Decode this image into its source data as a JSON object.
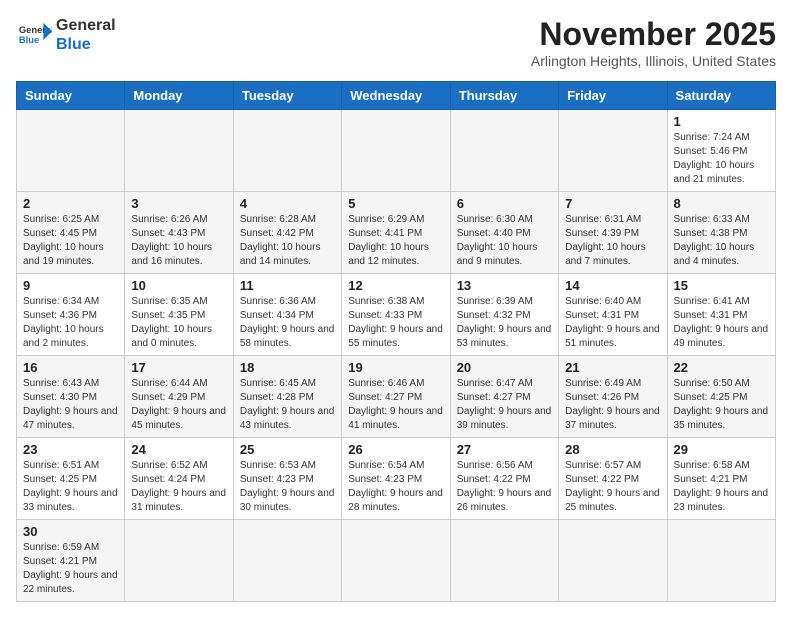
{
  "header": {
    "logo_general": "General",
    "logo_blue": "Blue",
    "month_year": "November 2025",
    "location": "Arlington Heights, Illinois, United States"
  },
  "weekdays": [
    "Sunday",
    "Monday",
    "Tuesday",
    "Wednesday",
    "Thursday",
    "Friday",
    "Saturday"
  ],
  "weeks": [
    [
      {
        "day": "",
        "info": ""
      },
      {
        "day": "",
        "info": ""
      },
      {
        "day": "",
        "info": ""
      },
      {
        "day": "",
        "info": ""
      },
      {
        "day": "",
        "info": ""
      },
      {
        "day": "",
        "info": ""
      },
      {
        "day": "1",
        "info": "Sunrise: 7:24 AM\nSunset: 5:46 PM\nDaylight: 10 hours and 21 minutes."
      }
    ],
    [
      {
        "day": "2",
        "info": "Sunrise: 6:25 AM\nSunset: 4:45 PM\nDaylight: 10 hours and 19 minutes."
      },
      {
        "day": "3",
        "info": "Sunrise: 6:26 AM\nSunset: 4:43 PM\nDaylight: 10 hours and 16 minutes."
      },
      {
        "day": "4",
        "info": "Sunrise: 6:28 AM\nSunset: 4:42 PM\nDaylight: 10 hours and 14 minutes."
      },
      {
        "day": "5",
        "info": "Sunrise: 6:29 AM\nSunset: 4:41 PM\nDaylight: 10 hours and 12 minutes."
      },
      {
        "day": "6",
        "info": "Sunrise: 6:30 AM\nSunset: 4:40 PM\nDaylight: 10 hours and 9 minutes."
      },
      {
        "day": "7",
        "info": "Sunrise: 6:31 AM\nSunset: 4:39 PM\nDaylight: 10 hours and 7 minutes."
      },
      {
        "day": "8",
        "info": "Sunrise: 6:33 AM\nSunset: 4:38 PM\nDaylight: 10 hours and 4 minutes."
      }
    ],
    [
      {
        "day": "9",
        "info": "Sunrise: 6:34 AM\nSunset: 4:36 PM\nDaylight: 10 hours and 2 minutes."
      },
      {
        "day": "10",
        "info": "Sunrise: 6:35 AM\nSunset: 4:35 PM\nDaylight: 10 hours and 0 minutes."
      },
      {
        "day": "11",
        "info": "Sunrise: 6:36 AM\nSunset: 4:34 PM\nDaylight: 9 hours and 58 minutes."
      },
      {
        "day": "12",
        "info": "Sunrise: 6:38 AM\nSunset: 4:33 PM\nDaylight: 9 hours and 55 minutes."
      },
      {
        "day": "13",
        "info": "Sunrise: 6:39 AM\nSunset: 4:32 PM\nDaylight: 9 hours and 53 minutes."
      },
      {
        "day": "14",
        "info": "Sunrise: 6:40 AM\nSunset: 4:31 PM\nDaylight: 9 hours and 51 minutes."
      },
      {
        "day": "15",
        "info": "Sunrise: 6:41 AM\nSunset: 4:31 PM\nDaylight: 9 hours and 49 minutes."
      }
    ],
    [
      {
        "day": "16",
        "info": "Sunrise: 6:43 AM\nSunset: 4:30 PM\nDaylight: 9 hours and 47 minutes."
      },
      {
        "day": "17",
        "info": "Sunrise: 6:44 AM\nSunset: 4:29 PM\nDaylight: 9 hours and 45 minutes."
      },
      {
        "day": "18",
        "info": "Sunrise: 6:45 AM\nSunset: 4:28 PM\nDaylight: 9 hours and 43 minutes."
      },
      {
        "day": "19",
        "info": "Sunrise: 6:46 AM\nSunset: 4:27 PM\nDaylight: 9 hours and 41 minutes."
      },
      {
        "day": "20",
        "info": "Sunrise: 6:47 AM\nSunset: 4:27 PM\nDaylight: 9 hours and 39 minutes."
      },
      {
        "day": "21",
        "info": "Sunrise: 6:49 AM\nSunset: 4:26 PM\nDaylight: 9 hours and 37 minutes."
      },
      {
        "day": "22",
        "info": "Sunrise: 6:50 AM\nSunset: 4:25 PM\nDaylight: 9 hours and 35 minutes."
      }
    ],
    [
      {
        "day": "23",
        "info": "Sunrise: 6:51 AM\nSunset: 4:25 PM\nDaylight: 9 hours and 33 minutes."
      },
      {
        "day": "24",
        "info": "Sunrise: 6:52 AM\nSunset: 4:24 PM\nDaylight: 9 hours and 31 minutes."
      },
      {
        "day": "25",
        "info": "Sunrise: 6:53 AM\nSunset: 4:23 PM\nDaylight: 9 hours and 30 minutes."
      },
      {
        "day": "26",
        "info": "Sunrise: 6:54 AM\nSunset: 4:23 PM\nDaylight: 9 hours and 28 minutes."
      },
      {
        "day": "27",
        "info": "Sunrise: 6:56 AM\nSunset: 4:22 PM\nDaylight: 9 hours and 26 minutes."
      },
      {
        "day": "28",
        "info": "Sunrise: 6:57 AM\nSunset: 4:22 PM\nDaylight: 9 hours and 25 minutes."
      },
      {
        "day": "29",
        "info": "Sunrise: 6:58 AM\nSunset: 4:21 PM\nDaylight: 9 hours and 23 minutes."
      }
    ],
    [
      {
        "day": "30",
        "info": "Sunrise: 6:59 AM\nSunset: 4:21 PM\nDaylight: 9 hours and 22 minutes."
      },
      {
        "day": "",
        "info": ""
      },
      {
        "day": "",
        "info": ""
      },
      {
        "day": "",
        "info": ""
      },
      {
        "day": "",
        "info": ""
      },
      {
        "day": "",
        "info": ""
      },
      {
        "day": "",
        "info": ""
      }
    ]
  ]
}
